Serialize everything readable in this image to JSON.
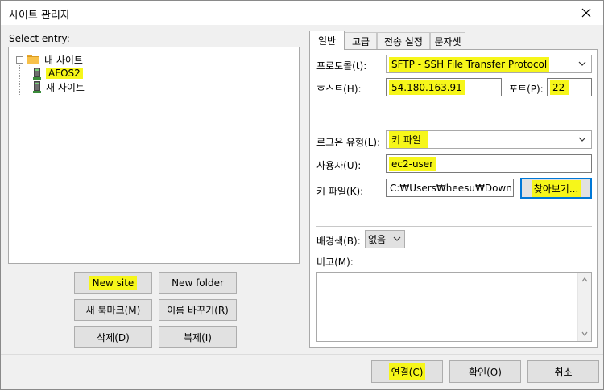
{
  "window": {
    "title": "사이트 관리자"
  },
  "left": {
    "select_label": "Select entry:",
    "tree": {
      "root": "내 사이트",
      "items": [
        "AFOS2",
        "새 사이트"
      ]
    },
    "buttons": {
      "new_site": "New site",
      "new_folder": "New folder",
      "new_bookmark": "새 북마크(M)",
      "rename": "이름 바꾸기(R)",
      "delete": "삭제(D)",
      "duplicate": "복제(I)"
    }
  },
  "tabs": [
    "일반",
    "고급",
    "전송 설정",
    "문자셋"
  ],
  "general": {
    "protocol_label": "프로토콜(t):",
    "protocol_value": "SFTP - SSH File Transfer Protocol",
    "host_label": "호스트(H):",
    "host_value": "54.180.163.91",
    "port_label": "포트(P):",
    "port_value": "22",
    "logon_type_label": "로그온 유형(L):",
    "logon_type_value": "키 파일",
    "user_label": "사용자(U):",
    "user_value": "ec2-user",
    "keyfile_label": "키 파일(K):",
    "keyfile_value": "C:₩Users₩heesu₩Downloac",
    "browse_label": "찾아보기...",
    "bgcolor_label": "배경색(B):",
    "bgcolor_value": "없음",
    "comment_label": "비고(M):"
  },
  "footer": {
    "connect": "연결(C)",
    "ok": "확인(O)",
    "cancel": "취소"
  },
  "colors": {
    "highlight": "#f6f61a",
    "focus": "#0078d7"
  }
}
